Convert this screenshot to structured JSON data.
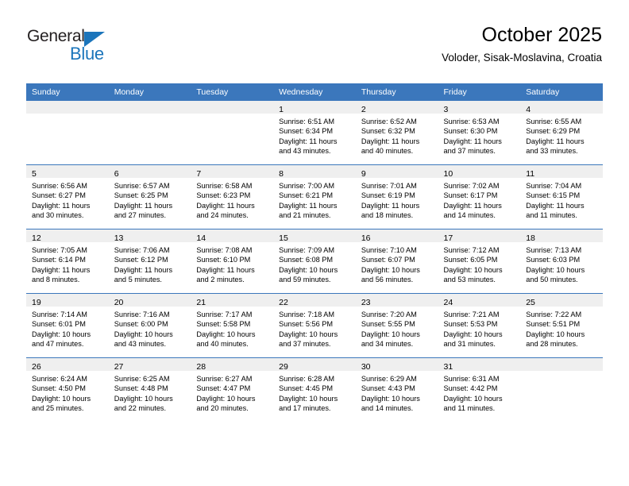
{
  "brand": {
    "name_part1": "General",
    "name_part2": "Blue",
    "triangle_color": "#1b75bb"
  },
  "header": {
    "title": "October 2025",
    "subtitle": "Voloder, Sisak-Moslavina, Croatia"
  },
  "theme": {
    "header_blue": "#3b77bc",
    "daystrip_gray": "#efefef",
    "text_black": "#000000"
  },
  "weekdays": [
    "Sunday",
    "Monday",
    "Tuesday",
    "Wednesday",
    "Thursday",
    "Friday",
    "Saturday"
  ],
  "weeks": [
    [
      {
        "day": "",
        "sunrise": "",
        "sunset": "",
        "daylight1": "",
        "daylight2": ""
      },
      {
        "day": "",
        "sunrise": "",
        "sunset": "",
        "daylight1": "",
        "daylight2": ""
      },
      {
        "day": "",
        "sunrise": "",
        "sunset": "",
        "daylight1": "",
        "daylight2": ""
      },
      {
        "day": "1",
        "sunrise": "Sunrise: 6:51 AM",
        "sunset": "Sunset: 6:34 PM",
        "daylight1": "Daylight: 11 hours",
        "daylight2": "and 43 minutes."
      },
      {
        "day": "2",
        "sunrise": "Sunrise: 6:52 AM",
        "sunset": "Sunset: 6:32 PM",
        "daylight1": "Daylight: 11 hours",
        "daylight2": "and 40 minutes."
      },
      {
        "day": "3",
        "sunrise": "Sunrise: 6:53 AM",
        "sunset": "Sunset: 6:30 PM",
        "daylight1": "Daylight: 11 hours",
        "daylight2": "and 37 minutes."
      },
      {
        "day": "4",
        "sunrise": "Sunrise: 6:55 AM",
        "sunset": "Sunset: 6:29 PM",
        "daylight1": "Daylight: 11 hours",
        "daylight2": "and 33 minutes."
      }
    ],
    [
      {
        "day": "5",
        "sunrise": "Sunrise: 6:56 AM",
        "sunset": "Sunset: 6:27 PM",
        "daylight1": "Daylight: 11 hours",
        "daylight2": "and 30 minutes."
      },
      {
        "day": "6",
        "sunrise": "Sunrise: 6:57 AM",
        "sunset": "Sunset: 6:25 PM",
        "daylight1": "Daylight: 11 hours",
        "daylight2": "and 27 minutes."
      },
      {
        "day": "7",
        "sunrise": "Sunrise: 6:58 AM",
        "sunset": "Sunset: 6:23 PM",
        "daylight1": "Daylight: 11 hours",
        "daylight2": "and 24 minutes."
      },
      {
        "day": "8",
        "sunrise": "Sunrise: 7:00 AM",
        "sunset": "Sunset: 6:21 PM",
        "daylight1": "Daylight: 11 hours",
        "daylight2": "and 21 minutes."
      },
      {
        "day": "9",
        "sunrise": "Sunrise: 7:01 AM",
        "sunset": "Sunset: 6:19 PM",
        "daylight1": "Daylight: 11 hours",
        "daylight2": "and 18 minutes."
      },
      {
        "day": "10",
        "sunrise": "Sunrise: 7:02 AM",
        "sunset": "Sunset: 6:17 PM",
        "daylight1": "Daylight: 11 hours",
        "daylight2": "and 14 minutes."
      },
      {
        "day": "11",
        "sunrise": "Sunrise: 7:04 AM",
        "sunset": "Sunset: 6:15 PM",
        "daylight1": "Daylight: 11 hours",
        "daylight2": "and 11 minutes."
      }
    ],
    [
      {
        "day": "12",
        "sunrise": "Sunrise: 7:05 AM",
        "sunset": "Sunset: 6:14 PM",
        "daylight1": "Daylight: 11 hours",
        "daylight2": "and 8 minutes."
      },
      {
        "day": "13",
        "sunrise": "Sunrise: 7:06 AM",
        "sunset": "Sunset: 6:12 PM",
        "daylight1": "Daylight: 11 hours",
        "daylight2": "and 5 minutes."
      },
      {
        "day": "14",
        "sunrise": "Sunrise: 7:08 AM",
        "sunset": "Sunset: 6:10 PM",
        "daylight1": "Daylight: 11 hours",
        "daylight2": "and 2 minutes."
      },
      {
        "day": "15",
        "sunrise": "Sunrise: 7:09 AM",
        "sunset": "Sunset: 6:08 PM",
        "daylight1": "Daylight: 10 hours",
        "daylight2": "and 59 minutes."
      },
      {
        "day": "16",
        "sunrise": "Sunrise: 7:10 AM",
        "sunset": "Sunset: 6:07 PM",
        "daylight1": "Daylight: 10 hours",
        "daylight2": "and 56 minutes."
      },
      {
        "day": "17",
        "sunrise": "Sunrise: 7:12 AM",
        "sunset": "Sunset: 6:05 PM",
        "daylight1": "Daylight: 10 hours",
        "daylight2": "and 53 minutes."
      },
      {
        "day": "18",
        "sunrise": "Sunrise: 7:13 AM",
        "sunset": "Sunset: 6:03 PM",
        "daylight1": "Daylight: 10 hours",
        "daylight2": "and 50 minutes."
      }
    ],
    [
      {
        "day": "19",
        "sunrise": "Sunrise: 7:14 AM",
        "sunset": "Sunset: 6:01 PM",
        "daylight1": "Daylight: 10 hours",
        "daylight2": "and 47 minutes."
      },
      {
        "day": "20",
        "sunrise": "Sunrise: 7:16 AM",
        "sunset": "Sunset: 6:00 PM",
        "daylight1": "Daylight: 10 hours",
        "daylight2": "and 43 minutes."
      },
      {
        "day": "21",
        "sunrise": "Sunrise: 7:17 AM",
        "sunset": "Sunset: 5:58 PM",
        "daylight1": "Daylight: 10 hours",
        "daylight2": "and 40 minutes."
      },
      {
        "day": "22",
        "sunrise": "Sunrise: 7:18 AM",
        "sunset": "Sunset: 5:56 PM",
        "daylight1": "Daylight: 10 hours",
        "daylight2": "and 37 minutes."
      },
      {
        "day": "23",
        "sunrise": "Sunrise: 7:20 AM",
        "sunset": "Sunset: 5:55 PM",
        "daylight1": "Daylight: 10 hours",
        "daylight2": "and 34 minutes."
      },
      {
        "day": "24",
        "sunrise": "Sunrise: 7:21 AM",
        "sunset": "Sunset: 5:53 PM",
        "daylight1": "Daylight: 10 hours",
        "daylight2": "and 31 minutes."
      },
      {
        "day": "25",
        "sunrise": "Sunrise: 7:22 AM",
        "sunset": "Sunset: 5:51 PM",
        "daylight1": "Daylight: 10 hours",
        "daylight2": "and 28 minutes."
      }
    ],
    [
      {
        "day": "26",
        "sunrise": "Sunrise: 6:24 AM",
        "sunset": "Sunset: 4:50 PM",
        "daylight1": "Daylight: 10 hours",
        "daylight2": "and 25 minutes."
      },
      {
        "day": "27",
        "sunrise": "Sunrise: 6:25 AM",
        "sunset": "Sunset: 4:48 PM",
        "daylight1": "Daylight: 10 hours",
        "daylight2": "and 22 minutes."
      },
      {
        "day": "28",
        "sunrise": "Sunrise: 6:27 AM",
        "sunset": "Sunset: 4:47 PM",
        "daylight1": "Daylight: 10 hours",
        "daylight2": "and 20 minutes."
      },
      {
        "day": "29",
        "sunrise": "Sunrise: 6:28 AM",
        "sunset": "Sunset: 4:45 PM",
        "daylight1": "Daylight: 10 hours",
        "daylight2": "and 17 minutes."
      },
      {
        "day": "30",
        "sunrise": "Sunrise: 6:29 AM",
        "sunset": "Sunset: 4:43 PM",
        "daylight1": "Daylight: 10 hours",
        "daylight2": "and 14 minutes."
      },
      {
        "day": "31",
        "sunrise": "Sunrise: 6:31 AM",
        "sunset": "Sunset: 4:42 PM",
        "daylight1": "Daylight: 10 hours",
        "daylight2": "and 11 minutes."
      },
      {
        "day": "",
        "sunrise": "",
        "sunset": "",
        "daylight1": "",
        "daylight2": ""
      }
    ]
  ]
}
